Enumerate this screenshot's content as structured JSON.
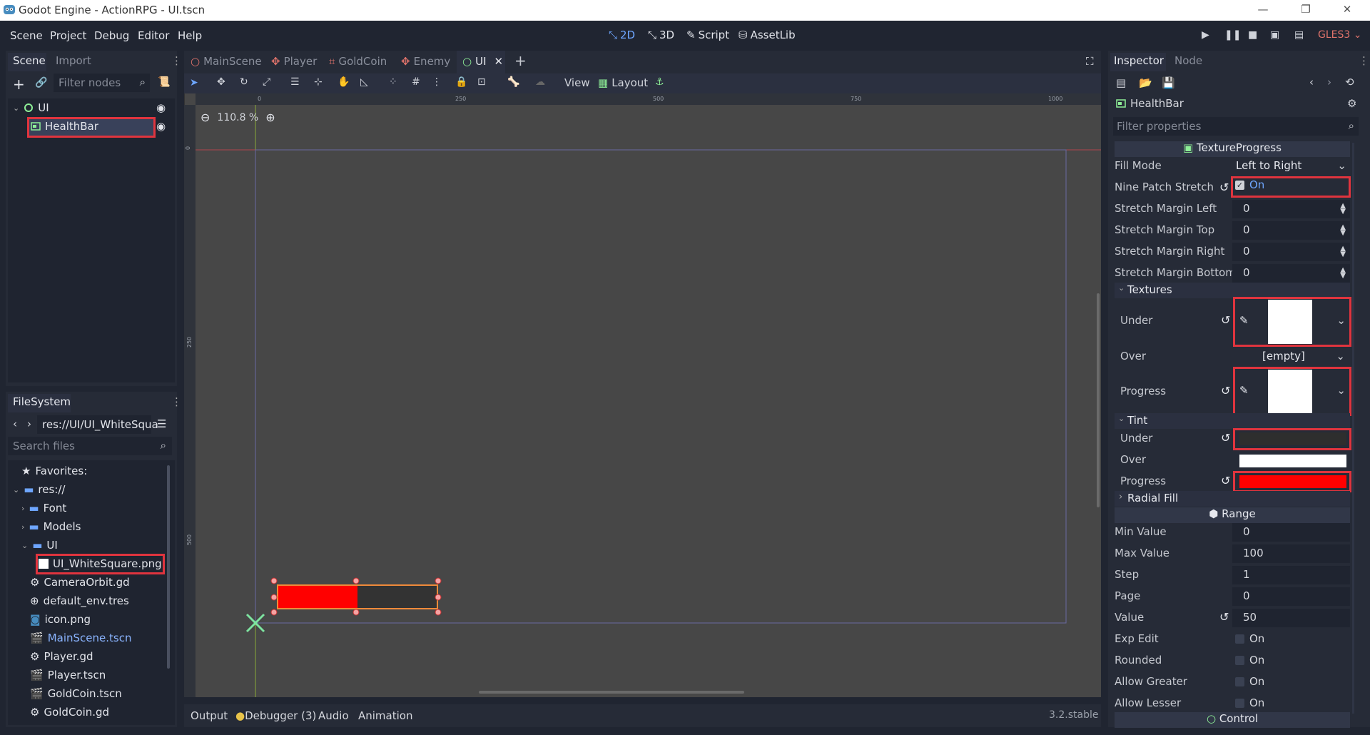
{
  "window": {
    "title": "Godot Engine - ActionRPG - UI.tscn"
  },
  "menu": [
    "Scene",
    "Project",
    "Debug",
    "Editor",
    "Help"
  ],
  "modes": {
    "two_d": "2D",
    "three_d": "3D",
    "script": "Script",
    "assetlib": "AssetLib"
  },
  "renderer": "GLES3",
  "scene_dock": {
    "tabs": [
      "Scene",
      "Import"
    ],
    "filter_placeholder": "Filter nodes",
    "tree": [
      {
        "label": "UI"
      },
      {
        "label": "HealthBar"
      }
    ]
  },
  "filesystem": {
    "tab": "FileSystem",
    "path": "res://UI/UI_WhiteSqua",
    "search_placeholder": "Search files",
    "items": [
      "Favorites:",
      "res://",
      "Font",
      "Models",
      "UI",
      "UI_WhiteSquare.png",
      "CameraOrbit.gd",
      "default_env.tres",
      "icon.png",
      "MainScene.tscn",
      "Player.gd",
      "Player.tscn",
      "GoldCoin.tscn",
      "GoldCoin.gd"
    ]
  },
  "editor": {
    "tabs": [
      "MainScene",
      "Player",
      "GoldCoin",
      "Enemy",
      "UI"
    ],
    "toolbar": {
      "view": "View",
      "layout": "Layout"
    },
    "zoom": "110.8 %",
    "ruler_top": [
      "0",
      "250",
      "500",
      "750",
      "1000"
    ],
    "ruler_left": [
      "0",
      "250",
      "500"
    ],
    "healthbar": {
      "value": 50,
      "max": 100,
      "under_color": "#333333",
      "progress_color": "#ff0000"
    }
  },
  "bottom": {
    "tabs": [
      "Output",
      "Debugger (3)",
      "Audio",
      "Animation"
    ],
    "version": "3.2.stable"
  },
  "inspector": {
    "tabs": [
      "Inspector",
      "Node"
    ],
    "node": "HealthBar",
    "filter_placeholder": "Filter properties",
    "class": "TextureProgress",
    "fill_mode": {
      "label": "Fill Mode",
      "value": "Left to Right"
    },
    "nine_patch": {
      "label": "Nine Patch Stretch",
      "value": "On"
    },
    "margins": [
      {
        "label": "Stretch Margin Left",
        "value": "0"
      },
      {
        "label": "Stretch Margin Top",
        "value": "0"
      },
      {
        "label": "Stretch Margin Right",
        "value": "0"
      },
      {
        "label": "Stretch Margin Bottom",
        "value": "0"
      }
    ],
    "textures": {
      "header": "Textures",
      "under": "Under",
      "over": "Over",
      "over_value": "[empty]",
      "progress": "Progress"
    },
    "tint": {
      "header": "Tint",
      "under": "Under",
      "under_color": "#2e2e2e",
      "over": "Over",
      "over_color": "#ffffff",
      "progress": "Progress",
      "progress_color": "#ff0000"
    },
    "radial_fill": "Radial Fill",
    "range": {
      "header": "Range",
      "rows": [
        {
          "label": "Min Value",
          "value": "0"
        },
        {
          "label": "Max Value",
          "value": "100"
        },
        {
          "label": "Step",
          "value": "1"
        },
        {
          "label": "Page",
          "value": "0"
        },
        {
          "label": "Value",
          "value": "50"
        }
      ],
      "checks": [
        {
          "label": "Exp Edit",
          "value": "On"
        },
        {
          "label": "Rounded",
          "value": "On"
        },
        {
          "label": "Allow Greater",
          "value": "On"
        },
        {
          "label": "Allow Lesser",
          "value": "On"
        }
      ]
    },
    "control": "Control"
  }
}
